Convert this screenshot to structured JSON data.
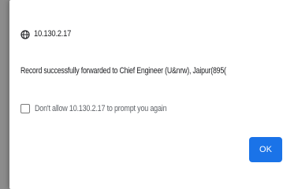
{
  "dialog": {
    "origin": "10.130.2.17",
    "origin_icon": "globe-icon",
    "message": "Record successfully forwarded to Chief Engineer (U&nrw), Jaipur(895(",
    "suppress_checkbox_label": "Don't allow 10.130.2.17 to prompt you again",
    "ok_label": "OK"
  },
  "colors": {
    "accent": "#1a73e8",
    "backdrop": "#8c8c8c"
  }
}
